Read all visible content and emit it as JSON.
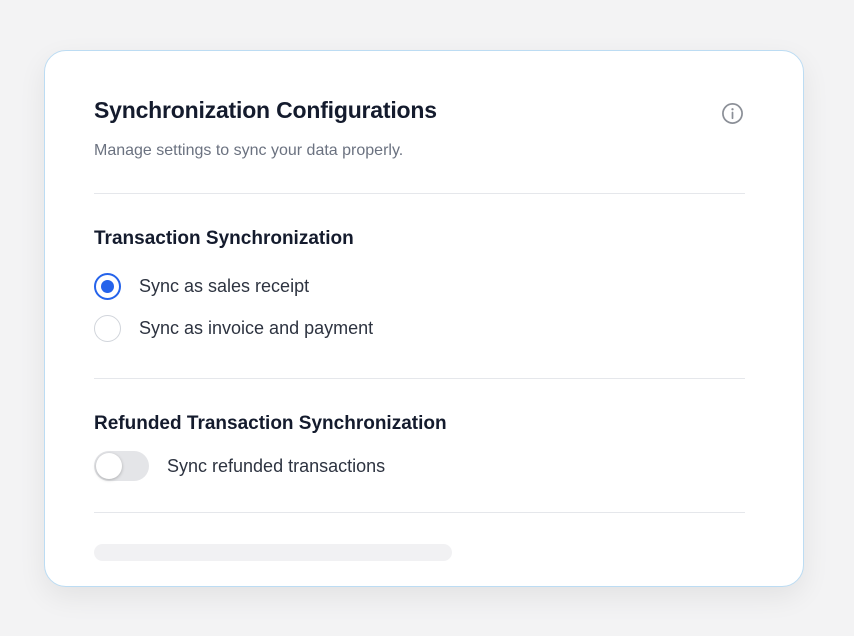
{
  "header": {
    "title": "Synchronization Configurations",
    "subtitle": "Manage settings to sync your data properly.",
    "info_icon": "info-circle-icon"
  },
  "transaction_sync": {
    "title": "Transaction Synchronization",
    "options": [
      {
        "label": "Sync as sales receipt",
        "selected": true
      },
      {
        "label": "Sync as invoice and payment",
        "selected": false
      }
    ]
  },
  "refund_sync": {
    "title": "Refunded Transaction Synchronization",
    "toggle_label": "Sync refunded transactions",
    "toggle_on": false
  },
  "colors": {
    "accent": "#2563eb",
    "card_border": "#bcdcf3",
    "heading": "#141b2d",
    "muted": "#6b7280"
  }
}
